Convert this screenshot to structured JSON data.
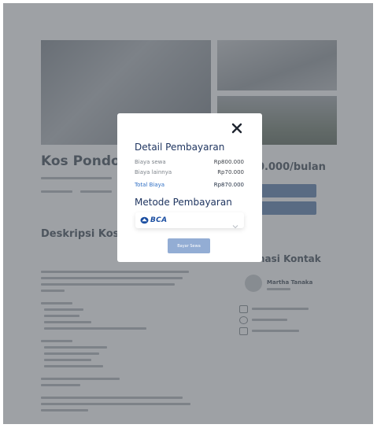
{
  "background_page": {
    "listing_title": "Kos Pondok",
    "price": "0.000/bulan",
    "description_heading": "Deskripsi Kos",
    "contact_heading": "nasi Kontak",
    "owner_name": "Martha Tanaka"
  },
  "modal": {
    "close_glyph": "✕",
    "payment_detail_title": "Detail Pembayaran",
    "rows": [
      {
        "label": "Biaya sewa",
        "value": "Rp800.000"
      },
      {
        "label": "Biaya lainnya",
        "value": "Rp70.000"
      },
      {
        "label": "Total Biaya",
        "value": "Rp870.000"
      }
    ],
    "payment_method_title": "Metode Pembayaran",
    "selected_bank": "BCA",
    "pay_button_label": "Bayar Sewa"
  },
  "colors": {
    "heading": "#1f3560",
    "accent": "#2f6fc4",
    "button": "#93add4",
    "bca_blue": "#1b4ea1"
  },
  "icons": [
    "close-icon",
    "bca-logo-icon",
    "chevron-down-icon"
  ]
}
